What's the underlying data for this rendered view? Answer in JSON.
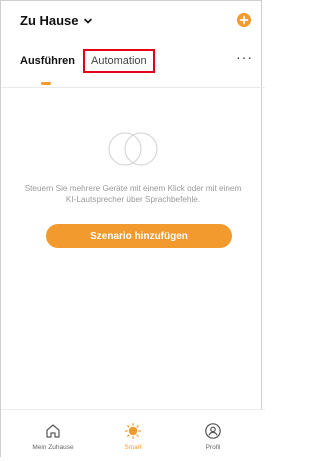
{
  "header": {
    "home_title": "Zu Hause",
    "more": "···"
  },
  "tabs": [
    {
      "label": "Ausführen",
      "active": true
    },
    {
      "label": "Automation",
      "active": false
    }
  ],
  "empty_state": {
    "icon": "overlapping-circles-icon",
    "text": "Steuern Sie mehrere Geräte mit einem Klick oder mit einem KI-Lautsprecher über Sprachbefehle.",
    "cta_label": "Szenario hinzufügen"
  },
  "bottom_nav": [
    {
      "label": "Mein Zuhause",
      "icon": "home-icon",
      "active": false
    },
    {
      "label": "Smart",
      "icon": "sun-icon",
      "active": true
    },
    {
      "label": "Profil",
      "icon": "profile-icon",
      "active": false
    }
  ],
  "colors": {
    "accent": "#f29a2e",
    "highlight_border": "#e6001a",
    "muted_text": "#9a9a9a"
  }
}
